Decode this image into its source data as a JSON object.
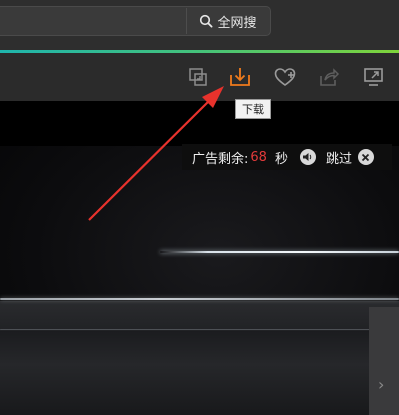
{
  "search": {
    "button_label": "全网搜",
    "icon": "search-icon"
  },
  "toolbar": {
    "icons": [
      "screenshot-icon",
      "download-icon",
      "favorite-icon",
      "share-icon",
      "cast-icon"
    ],
    "download_tooltip": "下载"
  },
  "ad": {
    "label": "广告剩余:",
    "count": "68",
    "unit": "秒",
    "skip_label": "跳过"
  },
  "colors": {
    "accent_orange": "#f07b1c",
    "accent_green": "#45c27a",
    "countdown_red": "#e23a3a",
    "arrow_red": "#e8322c"
  }
}
